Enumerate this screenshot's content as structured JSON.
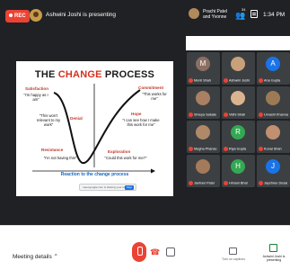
{
  "topbar": {
    "rec_label": "REC",
    "presenting_text": "Ashwini Joshi is presenting",
    "pinned_name": "Prachi Patel and Yvonne",
    "people_count": "34",
    "time": "1:34 PM"
  },
  "slide": {
    "title_prefix": "THE ",
    "title_highlight": "CHANGE",
    "title_suffix": " PROCESS",
    "satisfaction": {
      "heading": "Satisfaction",
      "quote": "\"I'm happy as I am\""
    },
    "denial": {
      "heading": "Denial",
      "quote": "\"This won't relevant to my work\""
    },
    "resistance": {
      "heading": "Resistance",
      "quote": "\"I'm not having this\""
    },
    "exploration": {
      "heading": "Exploration",
      "quote": "\"Could this work for me?\""
    },
    "hope": {
      "heading": "Hope",
      "quote": "\"I can see how I make this work for me\""
    },
    "commitment": {
      "heading": "Commitment",
      "quote": "\"This works for me\""
    },
    "reaction": "Reaction to the change process",
    "share_bar_text": "meet.google.com is sharing your screen",
    "share_bar_button": "Stop"
  },
  "participants": [
    {
      "initial": "M",
      "name": "Monil Shah",
      "color": "#8d6e63"
    },
    {
      "initial": "",
      "name": "Ashwini Joshi",
      "color": "#c8a07a"
    },
    {
      "initial": "A",
      "name": "Ana Gupta",
      "color": "#1a73e8"
    },
    {
      "initial": "",
      "name": "Shreya Sabale",
      "color": "#a98064"
    },
    {
      "initial": "",
      "name": "Vidhi Shah",
      "color": "#d9b48f"
    },
    {
      "initial": "",
      "name": "Urvashi Khanna",
      "color": "#9c7a54"
    },
    {
      "initial": "",
      "name": "Megha Phanse",
      "color": "#b08968"
    },
    {
      "initial": "R",
      "name": "Riya Gupta",
      "color": "#33a852"
    },
    {
      "initial": "",
      "name": "Kunal Shah",
      "color": "#c09070"
    },
    {
      "initial": "",
      "name": "Janhavi Patel",
      "color": "#a57a5a"
    },
    {
      "initial": "H",
      "name": "Himani Bhat",
      "color": "#34a853"
    },
    {
      "initial": "J",
      "name": "Jayshree Desai",
      "color": "#1a73e8"
    }
  ],
  "bottombar": {
    "meeting_details": "Meeting details",
    "captions_label": "Turn on captions",
    "present_label": "Ashwini Joshi is presenting"
  }
}
